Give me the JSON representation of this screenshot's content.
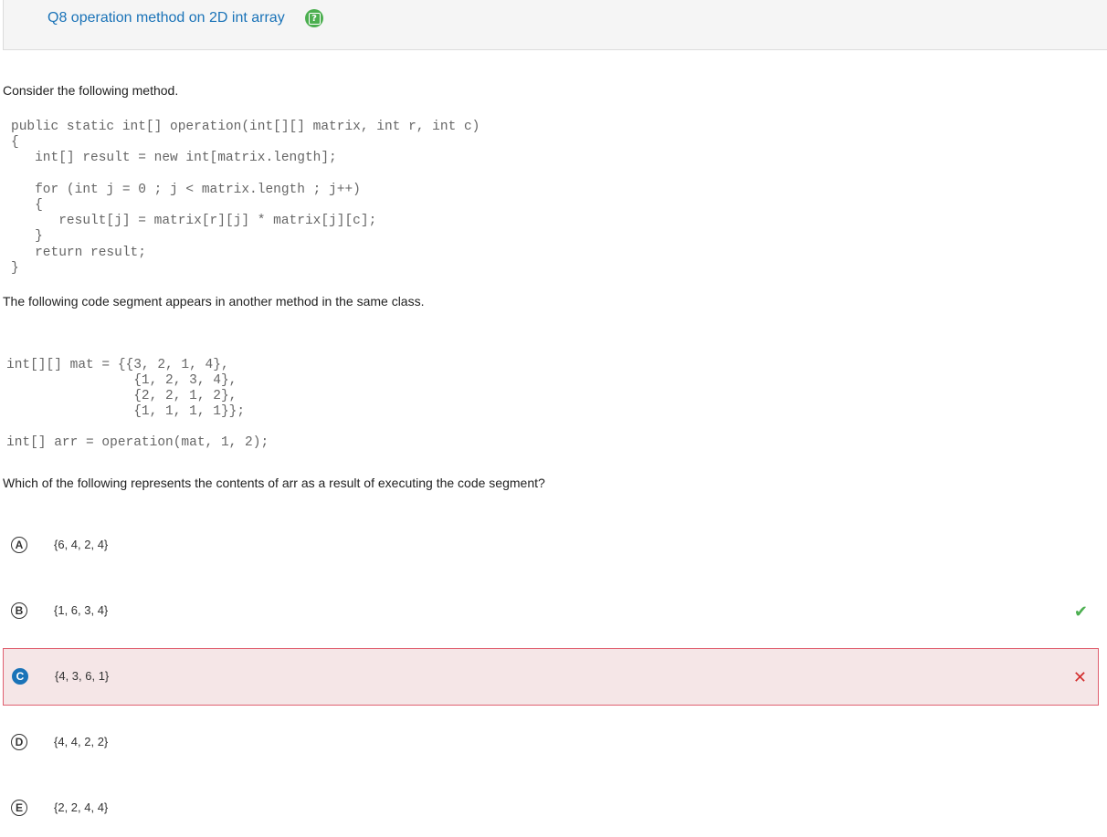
{
  "question": {
    "title": "Q8 operation method on 2D int array",
    "help_icon": "help-icon"
  },
  "prompt": {
    "intro": "Consider the following method.",
    "method_code": "public static int[] operation(int[][] matrix, int r, int c)\n{\n   int[] result = new int[matrix.length];\n\n   for (int j = 0 ; j < matrix.length ; j++)\n   {\n      result[j] = matrix[r][j] * matrix[j][c];\n   }\n   return result;\n}",
    "segment_intro": "The following code segment appears in another method in the same class.",
    "segment_code": "int[][] mat = {{3, 2, 1, 4},\n                {1, 2, 3, 4},\n                {2, 2, 1, 2},\n                {1, 1, 1, 1}};\n\nint[] arr = operation(mat, 1, 2);",
    "question_text": "Which of the following represents the contents of arr as a result of executing the code segment?"
  },
  "choices": [
    {
      "letter": "A",
      "text": "{6, 4, 2, 4}",
      "state": "none"
    },
    {
      "letter": "B",
      "text": "{1, 6, 3, 4}",
      "state": "correct",
      "mark": "✔"
    },
    {
      "letter": "C",
      "text": "{4, 3, 6, 1}",
      "state": "selected-wrong",
      "mark": "✕"
    },
    {
      "letter": "D",
      "text": "{4, 4, 2, 2}",
      "state": "none"
    },
    {
      "letter": "E",
      "text": "{2, 2, 4, 4}",
      "state": "none"
    }
  ],
  "colors": {
    "accent": "#1a73b8",
    "correct": "#4caf50",
    "wrong": "#d32f2f",
    "selected_bg": "#f5e6e7"
  }
}
